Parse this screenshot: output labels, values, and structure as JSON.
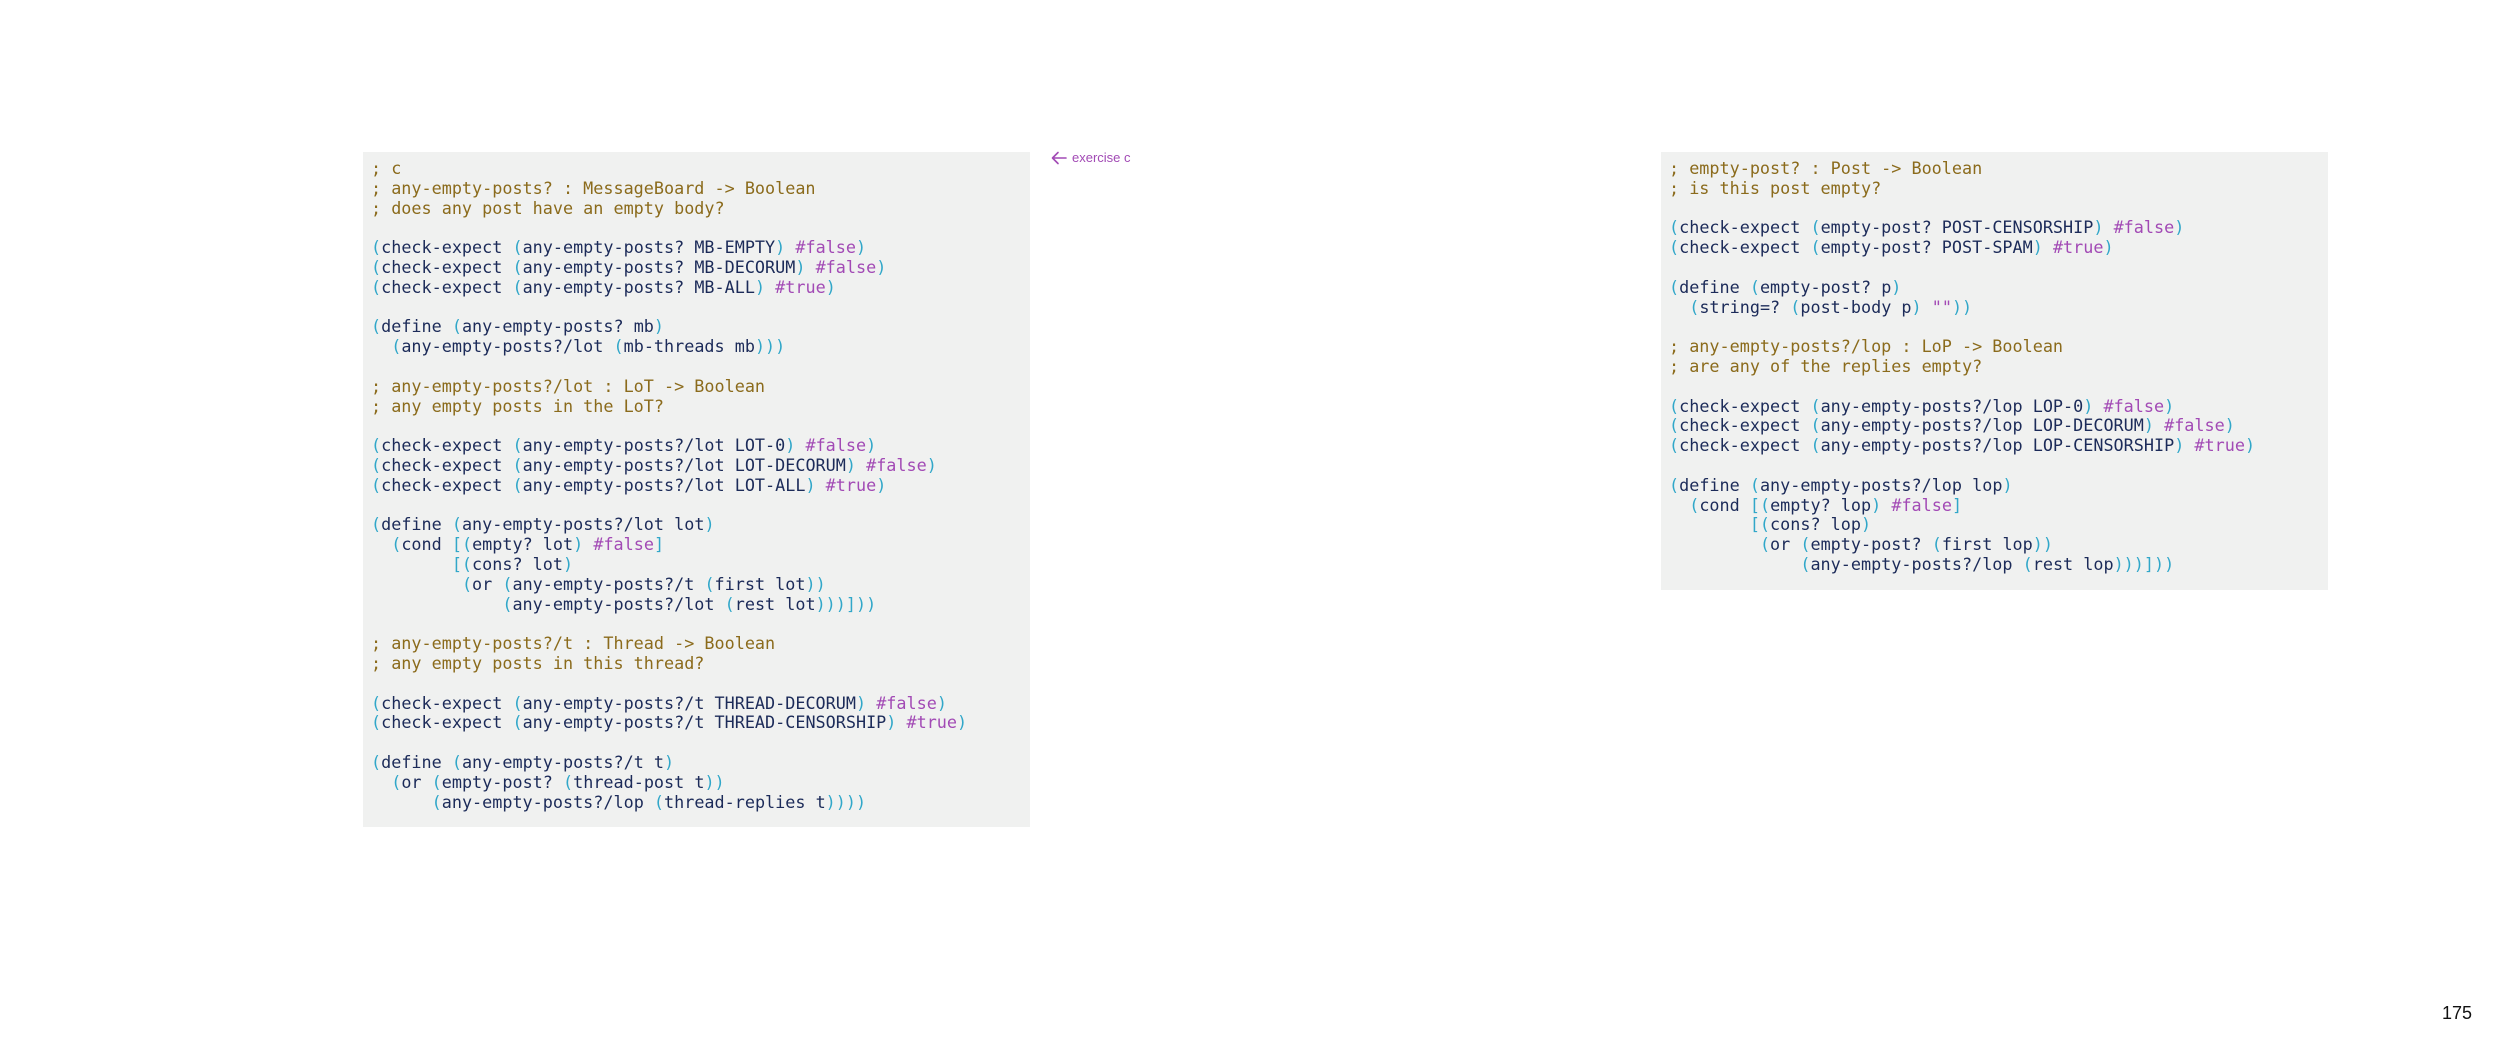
{
  "margin_note": {
    "label": "exercise c",
    "icon": "arrow-left-icon",
    "color": "#a24ab5"
  },
  "page_number": "175",
  "colors": {
    "comment": "#8b6b1c",
    "paren": "#31a7c9",
    "boolean": "#a24ab5",
    "identifier": "#1c2b59",
    "background": "#f0f1f0"
  },
  "code_left": [
    [
      [
        "c",
        "; c"
      ]
    ],
    [
      [
        "c",
        "; any-empty-posts? : MessageBoard -> Boolean"
      ]
    ],
    [
      [
        "c",
        "; does any post have an empty body?"
      ]
    ],
    [],
    [
      [
        "p",
        "("
      ],
      [
        "n",
        "check-expect "
      ],
      [
        "p",
        "("
      ],
      [
        "n",
        "any-empty-posts? MB-EMPTY"
      ],
      [
        "p",
        ")"
      ],
      [
        "n",
        " "
      ],
      [
        "f",
        "#false"
      ],
      [
        "p",
        ")"
      ]
    ],
    [
      [
        "p",
        "("
      ],
      [
        "n",
        "check-expect "
      ],
      [
        "p",
        "("
      ],
      [
        "n",
        "any-empty-posts? MB-DECORUM"
      ],
      [
        "p",
        ")"
      ],
      [
        "n",
        " "
      ],
      [
        "f",
        "#false"
      ],
      [
        "p",
        ")"
      ]
    ],
    [
      [
        "p",
        "("
      ],
      [
        "n",
        "check-expect "
      ],
      [
        "p",
        "("
      ],
      [
        "n",
        "any-empty-posts? MB-ALL"
      ],
      [
        "p",
        ")"
      ],
      [
        "n",
        " "
      ],
      [
        "t",
        "#true"
      ],
      [
        "p",
        ")"
      ]
    ],
    [],
    [
      [
        "p",
        "("
      ],
      [
        "n",
        "define "
      ],
      [
        "p",
        "("
      ],
      [
        "n",
        "any-empty-posts? mb"
      ],
      [
        "p",
        ")"
      ]
    ],
    [
      [
        "n",
        "  "
      ],
      [
        "p",
        "("
      ],
      [
        "n",
        "any-empty-posts?/lot "
      ],
      [
        "p",
        "("
      ],
      [
        "n",
        "mb-threads mb"
      ],
      [
        "p",
        ")))"
      ]
    ],
    [],
    [
      [
        "c",
        "; any-empty-posts?/lot : LoT -> Boolean"
      ]
    ],
    [
      [
        "c",
        "; any empty posts in the LoT?"
      ]
    ],
    [],
    [
      [
        "p",
        "("
      ],
      [
        "n",
        "check-expect "
      ],
      [
        "p",
        "("
      ],
      [
        "n",
        "any-empty-posts?/lot LOT-0"
      ],
      [
        "p",
        ")"
      ],
      [
        "n",
        " "
      ],
      [
        "f",
        "#false"
      ],
      [
        "p",
        ")"
      ]
    ],
    [
      [
        "p",
        "("
      ],
      [
        "n",
        "check-expect "
      ],
      [
        "p",
        "("
      ],
      [
        "n",
        "any-empty-posts?/lot LOT-DECORUM"
      ],
      [
        "p",
        ")"
      ],
      [
        "n",
        " "
      ],
      [
        "f",
        "#false"
      ],
      [
        "p",
        ")"
      ]
    ],
    [
      [
        "p",
        "("
      ],
      [
        "n",
        "check-expect "
      ],
      [
        "p",
        "("
      ],
      [
        "n",
        "any-empty-posts?/lot LOT-ALL"
      ],
      [
        "p",
        ")"
      ],
      [
        "n",
        " "
      ],
      [
        "t",
        "#true"
      ],
      [
        "p",
        ")"
      ]
    ],
    [],
    [
      [
        "p",
        "("
      ],
      [
        "n",
        "define "
      ],
      [
        "p",
        "("
      ],
      [
        "n",
        "any-empty-posts?/lot lot"
      ],
      [
        "p",
        ")"
      ]
    ],
    [
      [
        "n",
        "  "
      ],
      [
        "p",
        "("
      ],
      [
        "n",
        "cond "
      ],
      [
        "p",
        "[("
      ],
      [
        "n",
        "empty? lot"
      ],
      [
        "p",
        ")"
      ],
      [
        "n",
        " "
      ],
      [
        "f",
        "#false"
      ],
      [
        "p",
        "]"
      ]
    ],
    [
      [
        "n",
        "        "
      ],
      [
        "p",
        "[("
      ],
      [
        "n",
        "cons? lot"
      ],
      [
        "p",
        ")"
      ]
    ],
    [
      [
        "n",
        "         "
      ],
      [
        "p",
        "("
      ],
      [
        "n",
        "or "
      ],
      [
        "p",
        "("
      ],
      [
        "n",
        "any-empty-posts?/t "
      ],
      [
        "p",
        "("
      ],
      [
        "n",
        "first lot"
      ],
      [
        "p",
        "))"
      ]
    ],
    [
      [
        "n",
        "             "
      ],
      [
        "p",
        "("
      ],
      [
        "n",
        "any-empty-posts?/lot "
      ],
      [
        "p",
        "("
      ],
      [
        "n",
        "rest lot"
      ],
      [
        "p",
        ")))]))"
      ]
    ],
    [],
    [
      [
        "c",
        "; any-empty-posts?/t : Thread -> Boolean"
      ]
    ],
    [
      [
        "c",
        "; any empty posts in this thread?"
      ]
    ],
    [],
    [
      [
        "p",
        "("
      ],
      [
        "n",
        "check-expect "
      ],
      [
        "p",
        "("
      ],
      [
        "n",
        "any-empty-posts?/t THREAD-DECORUM"
      ],
      [
        "p",
        ")"
      ],
      [
        "n",
        " "
      ],
      [
        "f",
        "#false"
      ],
      [
        "p",
        ")"
      ]
    ],
    [
      [
        "p",
        "("
      ],
      [
        "n",
        "check-expect "
      ],
      [
        "p",
        "("
      ],
      [
        "n",
        "any-empty-posts?/t THREAD-CENSORSHIP"
      ],
      [
        "p",
        ")"
      ],
      [
        "n",
        " "
      ],
      [
        "t",
        "#true"
      ],
      [
        "p",
        ")"
      ]
    ],
    [],
    [
      [
        "p",
        "("
      ],
      [
        "n",
        "define "
      ],
      [
        "p",
        "("
      ],
      [
        "n",
        "any-empty-posts?/t t"
      ],
      [
        "p",
        ")"
      ]
    ],
    [
      [
        "n",
        "  "
      ],
      [
        "p",
        "("
      ],
      [
        "n",
        "or "
      ],
      [
        "p",
        "("
      ],
      [
        "n",
        "empty-post? "
      ],
      [
        "p",
        "("
      ],
      [
        "n",
        "thread-post t"
      ],
      [
        "p",
        "))"
      ]
    ],
    [
      [
        "n",
        "      "
      ],
      [
        "p",
        "("
      ],
      [
        "n",
        "any-empty-posts?/lop "
      ],
      [
        "p",
        "("
      ],
      [
        "n",
        "thread-replies t"
      ],
      [
        "p",
        "))))"
      ]
    ]
  ],
  "code_right": [
    [
      [
        "c",
        "; empty-post? : Post -> Boolean"
      ]
    ],
    [
      [
        "c",
        "; is this post empty?"
      ]
    ],
    [],
    [
      [
        "p",
        "("
      ],
      [
        "n",
        "check-expect "
      ],
      [
        "p",
        "("
      ],
      [
        "n",
        "empty-post? POST-CENSORSHIP"
      ],
      [
        "p",
        ")"
      ],
      [
        "n",
        " "
      ],
      [
        "f",
        "#false"
      ],
      [
        "p",
        ")"
      ]
    ],
    [
      [
        "p",
        "("
      ],
      [
        "n",
        "check-expect "
      ],
      [
        "p",
        "("
      ],
      [
        "n",
        "empty-post? POST-SPAM"
      ],
      [
        "p",
        ")"
      ],
      [
        "n",
        " "
      ],
      [
        "t",
        "#true"
      ],
      [
        "p",
        ")"
      ]
    ],
    [],
    [
      [
        "p",
        "("
      ],
      [
        "n",
        "define "
      ],
      [
        "p",
        "("
      ],
      [
        "n",
        "empty-post? p"
      ],
      [
        "p",
        ")"
      ]
    ],
    [
      [
        "n",
        "  "
      ],
      [
        "p",
        "("
      ],
      [
        "n",
        "string=? "
      ],
      [
        "p",
        "("
      ],
      [
        "n",
        "post-body p"
      ],
      [
        "p",
        ")"
      ],
      [
        "n",
        " "
      ],
      [
        "f",
        "\"\""
      ],
      [
        "p",
        "))"
      ]
    ],
    [],
    [
      [
        "c",
        "; any-empty-posts?/lop : LoP -> Boolean"
      ]
    ],
    [
      [
        "c",
        "; are any of the replies empty?"
      ]
    ],
    [],
    [
      [
        "p",
        "("
      ],
      [
        "n",
        "check-expect "
      ],
      [
        "p",
        "("
      ],
      [
        "n",
        "any-empty-posts?/lop LOP-0"
      ],
      [
        "p",
        ")"
      ],
      [
        "n",
        " "
      ],
      [
        "f",
        "#false"
      ],
      [
        "p",
        ")"
      ]
    ],
    [
      [
        "p",
        "("
      ],
      [
        "n",
        "check-expect "
      ],
      [
        "p",
        "("
      ],
      [
        "n",
        "any-empty-posts?/lop LOP-DECORUM"
      ],
      [
        "p",
        ")"
      ],
      [
        "n",
        " "
      ],
      [
        "f",
        "#false"
      ],
      [
        "p",
        ")"
      ]
    ],
    [
      [
        "p",
        "("
      ],
      [
        "n",
        "check-expect "
      ],
      [
        "p",
        "("
      ],
      [
        "n",
        "any-empty-posts?/lop LOP-CENSORSHIP"
      ],
      [
        "p",
        ")"
      ],
      [
        "n",
        " "
      ],
      [
        "t",
        "#true"
      ],
      [
        "p",
        ")"
      ]
    ],
    [],
    [
      [
        "p",
        "("
      ],
      [
        "n",
        "define "
      ],
      [
        "p",
        "("
      ],
      [
        "n",
        "any-empty-posts?/lop lop"
      ],
      [
        "p",
        ")"
      ]
    ],
    [
      [
        "n",
        "  "
      ],
      [
        "p",
        "("
      ],
      [
        "n",
        "cond "
      ],
      [
        "p",
        "[("
      ],
      [
        "n",
        "empty? lop"
      ],
      [
        "p",
        ")"
      ],
      [
        "n",
        " "
      ],
      [
        "f",
        "#false"
      ],
      [
        "p",
        "]"
      ]
    ],
    [
      [
        "n",
        "        "
      ],
      [
        "p",
        "[("
      ],
      [
        "n",
        "cons? lop"
      ],
      [
        "p",
        ")"
      ]
    ],
    [
      [
        "n",
        "         "
      ],
      [
        "p",
        "("
      ],
      [
        "n",
        "or "
      ],
      [
        "p",
        "("
      ],
      [
        "n",
        "empty-post? "
      ],
      [
        "p",
        "("
      ],
      [
        "n",
        "first lop"
      ],
      [
        "p",
        "))"
      ]
    ],
    [
      [
        "n",
        "             "
      ],
      [
        "p",
        "("
      ],
      [
        "n",
        "any-empty-posts?/lop "
      ],
      [
        "p",
        "("
      ],
      [
        "n",
        "rest lop"
      ],
      [
        "p",
        ")))]))"
      ]
    ]
  ]
}
